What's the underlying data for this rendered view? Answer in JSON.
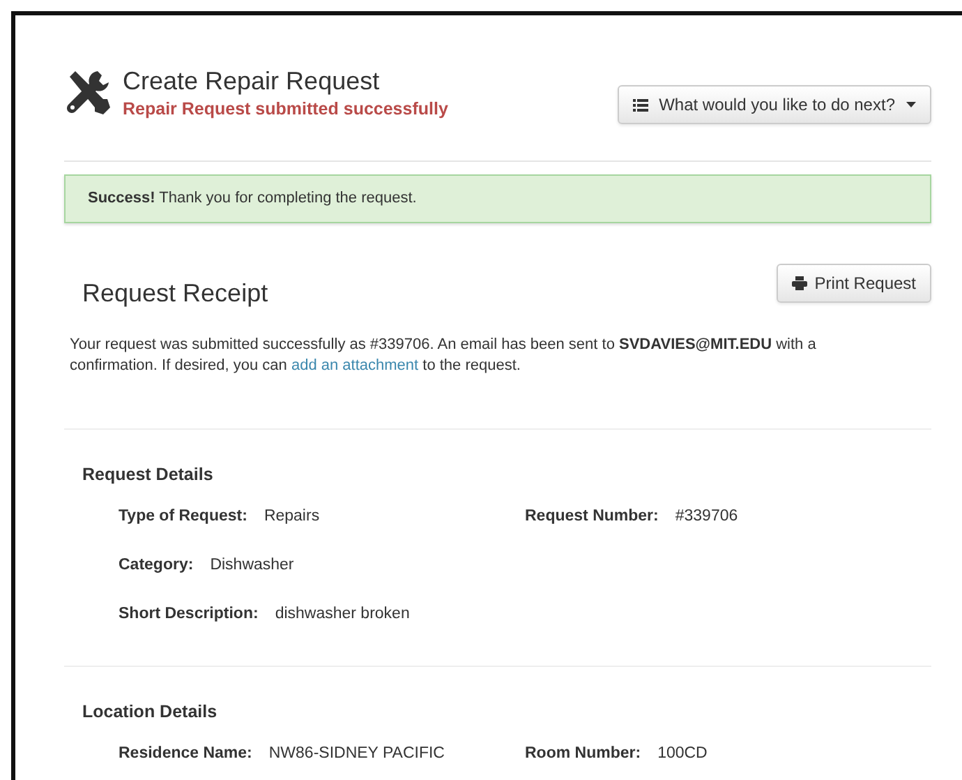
{
  "header": {
    "title": "Create Repair Request",
    "subtitle": "Repair Request submitted successfully",
    "menu_button": "What would you like to do next?"
  },
  "alert": {
    "strong": "Success!",
    "text": "Thank you for completing the request."
  },
  "receipt": {
    "title": "Request Receipt",
    "print_button": "Print Request",
    "message_before": "Your request was submitted successfully as #339706. An email has been sent to **SVDAVIES@MIT.EDU** with a confirmation. If desired, you can",
    "message_link": "add an attachment",
    "message_after": "to the request."
  },
  "sections": [
    {
      "title": "Request Details",
      "rows": [
        [
          {
            "label": "Type of Request:",
            "value": "Repairs"
          },
          {
            "label": "Request Number:",
            "value": "#339706"
          }
        ],
        [
          {
            "label": "Category:",
            "value": "Dishwasher"
          }
        ],
        [
          {
            "label": "Short Description:",
            "value": "dishwasher broken"
          }
        ]
      ]
    },
    {
      "title": "Location Details",
      "rows": [
        [
          {
            "label": "Residence Name:",
            "value": "NW86-SIDNEY PACIFIC"
          },
          {
            "label": "Room Number:",
            "value": "100CD"
          }
        ]
      ]
    }
  ]
}
